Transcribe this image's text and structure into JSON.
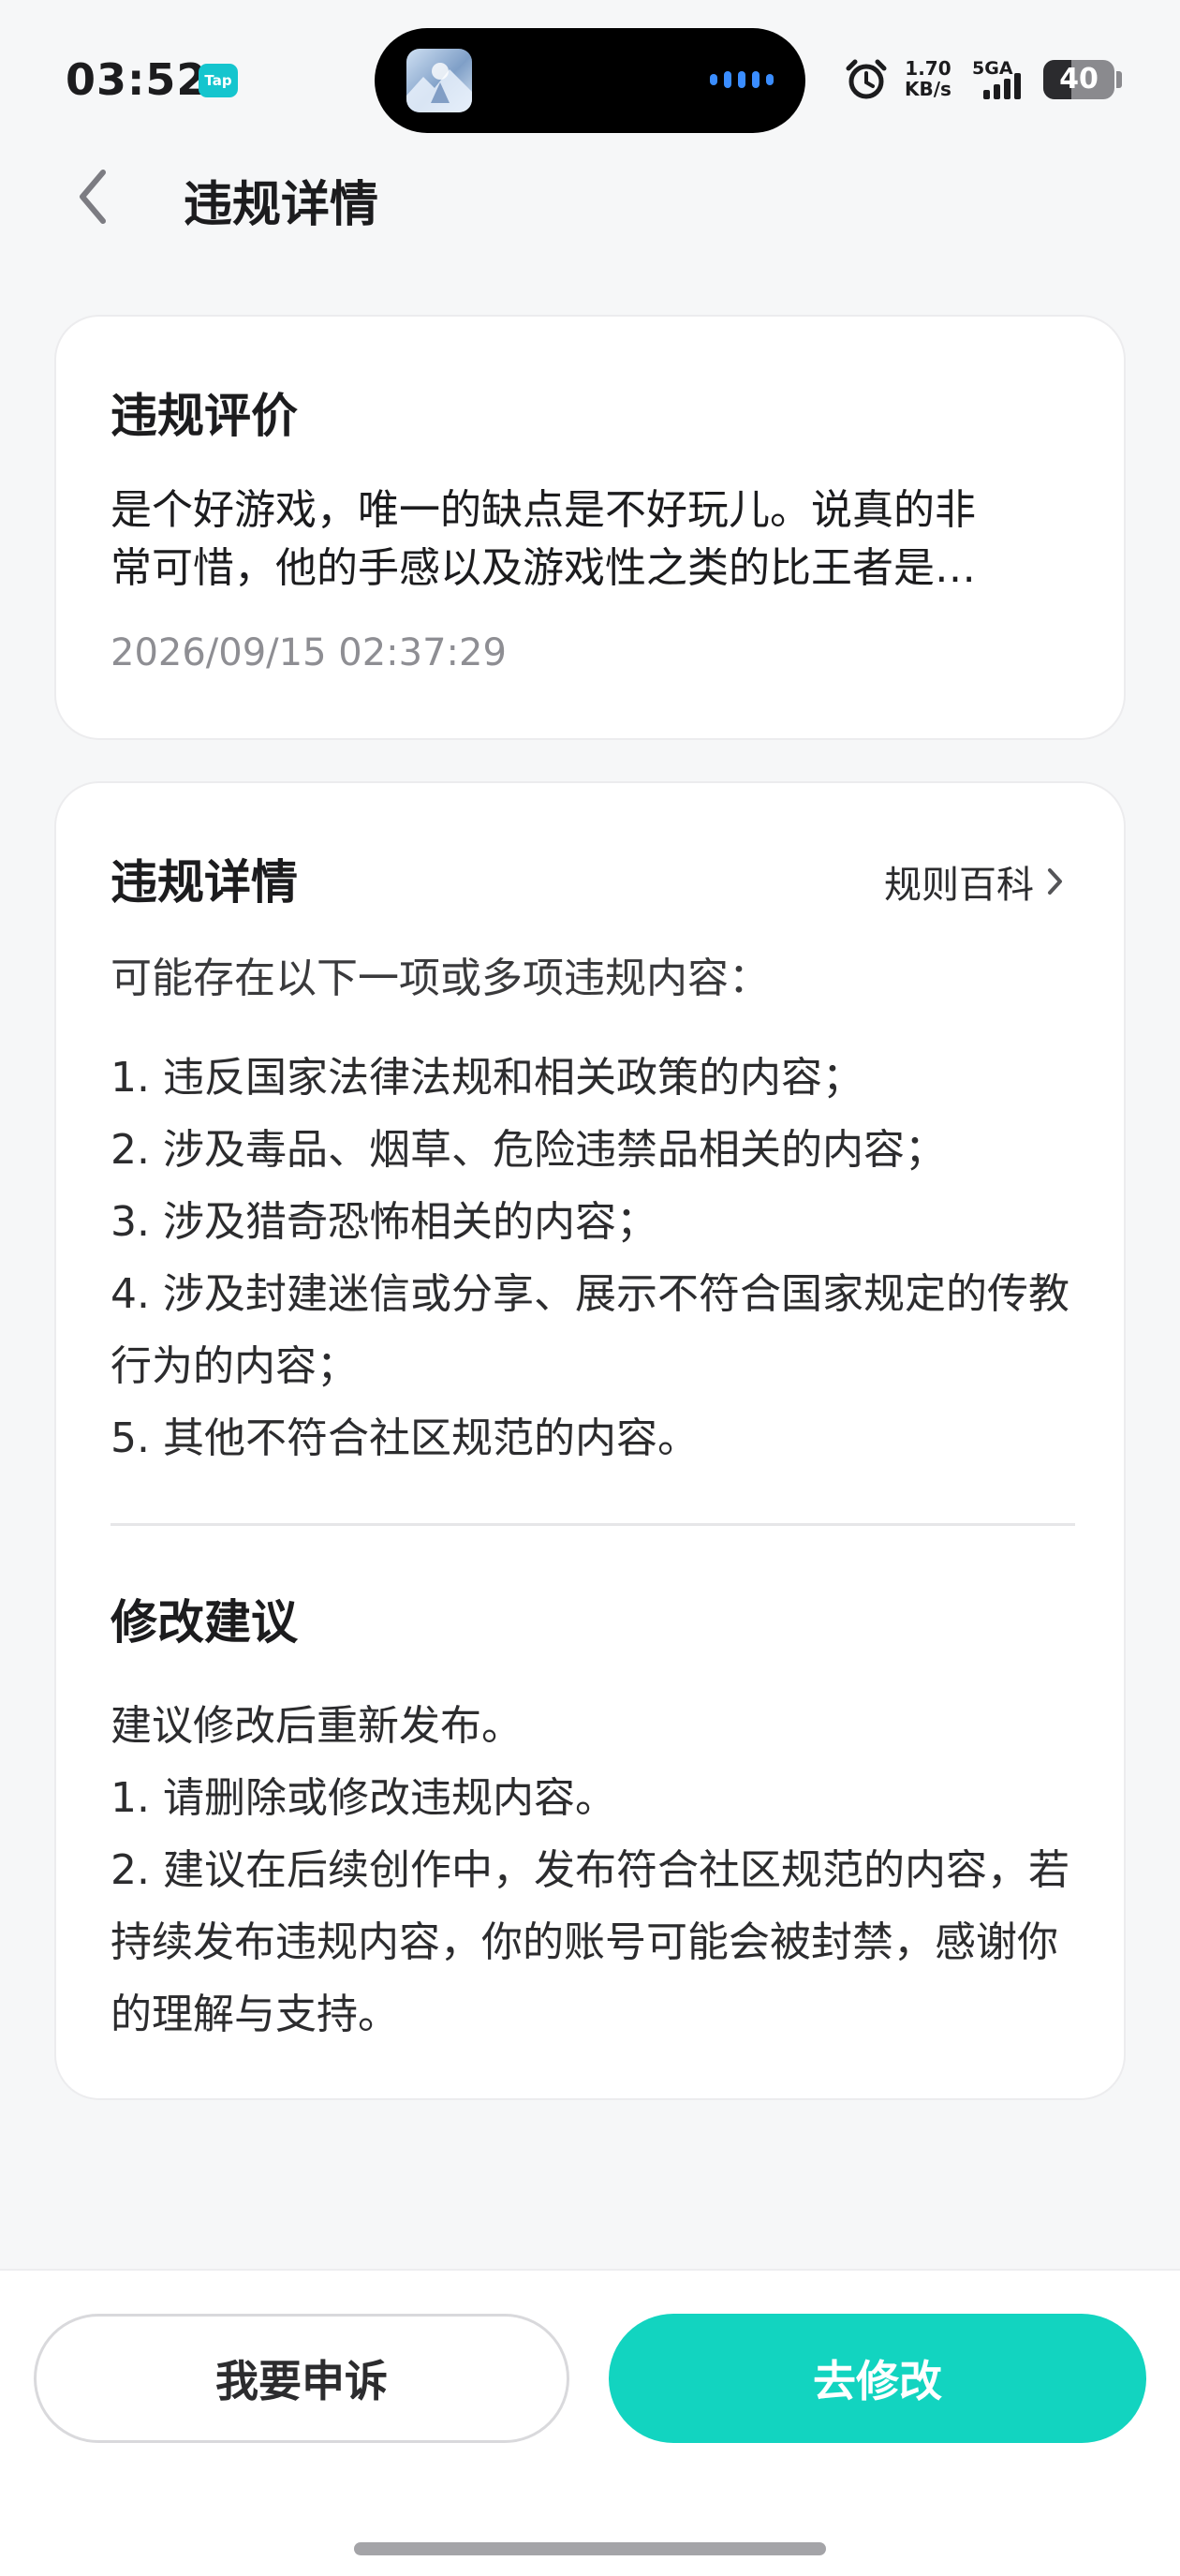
{
  "status_bar": {
    "time": "03:52",
    "app_badge": "Tap",
    "speed_value": "1.70",
    "speed_unit": "KB/s",
    "network": "5GA",
    "battery_level": "40",
    "battery_fraction": 0.4
  },
  "header": {
    "title": "违规详情"
  },
  "review_card": {
    "heading": "违规评价",
    "text_line1": "是个好游戏，唯一的缺点是不好玩儿。说真的非",
    "text_line2": "常可惜，他的手感以及游戏性之类的比王者是…",
    "timestamp": "2026/09/15 02:37:29"
  },
  "detail_card": {
    "heading": "违规详情",
    "rule_link_label": "规则百科",
    "intro": "可能存在以下一项或多项违规内容：",
    "items": [
      "1. 违反国家法律法规和相关政策的内容；",
      "2. 涉及毒品、烟草、危险违禁品相关的内容；",
      "3. 涉及猎奇恐怖相关的内容；",
      "4. 涉及封建迷信或分享、展示不符合国家规定的传教行为的内容；",
      "5. 其他不符合社区规范的内容。"
    ],
    "suggestion_heading": "修改建议",
    "suggestions": [
      "建议修改后重新发布。",
      "1. 请删除或修改违规内容。",
      "2. 建议在后续创作中，发布符合社区规范的内容，若持续发布违规内容，你的账号可能会被封禁，感谢你的理解与支持。"
    ]
  },
  "actions": {
    "appeal_label": "我要申诉",
    "fix_label": "去修改"
  },
  "colors": {
    "accent": "#12d4c0",
    "tap_badge": "#15c5ce",
    "muted_text": "#8e8e93"
  },
  "icons": [
    "alarm-icon",
    "signal-icon",
    "battery-icon",
    "back-arrow-icon",
    "chevron-right-icon"
  ]
}
